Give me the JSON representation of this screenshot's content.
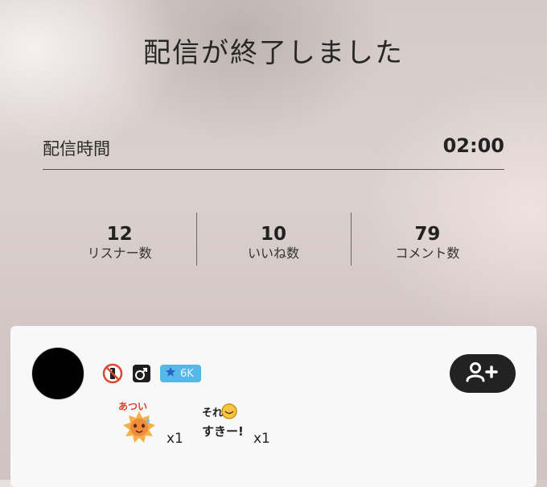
{
  "header": {
    "title": "配信が終了しました"
  },
  "duration": {
    "label": "配信時間",
    "value": "02:00"
  },
  "stats": [
    {
      "value": "12",
      "label": "リスナー数"
    },
    {
      "value": "10",
      "label": "いいね数"
    },
    {
      "value": "79",
      "label": "コメント数"
    }
  ],
  "profile": {
    "star_badge": "6K",
    "gifts": [
      {
        "icon": "atsui-sun-sticker",
        "sticker_text": "あつい",
        "count": "x1"
      },
      {
        "icon": "sore-suki-sticker",
        "sticker_text": "それすきー!",
        "count": "x1"
      }
    ]
  },
  "colors": {
    "card": "#f8f8f8",
    "follow_button": "#222222",
    "star_pill": "#56b8ea",
    "sun": "#f08a3c"
  }
}
